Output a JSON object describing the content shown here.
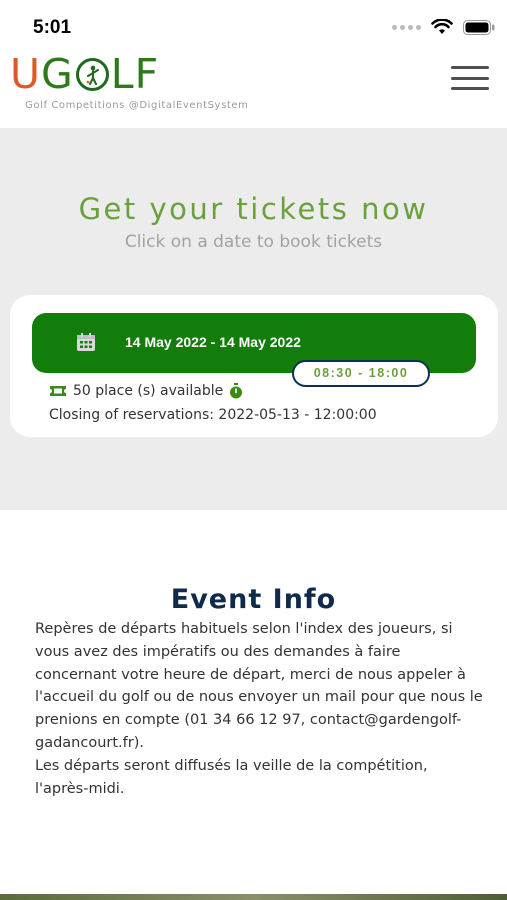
{
  "status_bar": {
    "time": "5:01"
  },
  "header": {
    "logo": {
      "u": "U",
      "g": "G",
      "rest": "LF"
    },
    "tagline": "Golf Competitions @DigitalEventSystem"
  },
  "hero": {
    "title": "Get your tickets now",
    "subtitle": "Click on a date to book tickets"
  },
  "ticket": {
    "date_range": "14 May 2022 - 14 May 2022",
    "time_range": "08:30 - 18:00",
    "places": "50 place (s) available",
    "closing": "Closing of reservations: 2022-05-13 - 12:00:00"
  },
  "event_info": {
    "title": "Event Info",
    "paragraph1": "Repères de départs habituels selon l'index des joueurs, si vous avez des impératifs ou des demandes à faire concernant votre heure de départ, merci de nous appeler à l'accueil du golf ou de nous envoyer un mail pour que nous le prenions en compte (01 34 66 12 97, contact@gardengolf-gadancourt.fr).",
    "paragraph2": "Les départs seront diffusés la veille de la compétition, l'après-midi."
  },
  "colors": {
    "brand_green": "#137d0b",
    "title_green": "#6aa13a",
    "logo_orange": "#e0582a",
    "navy": "#0f2a4a"
  },
  "icons": [
    "wifi-icon",
    "battery-icon",
    "menu-icon",
    "calendar-icon",
    "ticket-icon",
    "stopwatch-icon",
    "golfer-icon"
  ]
}
